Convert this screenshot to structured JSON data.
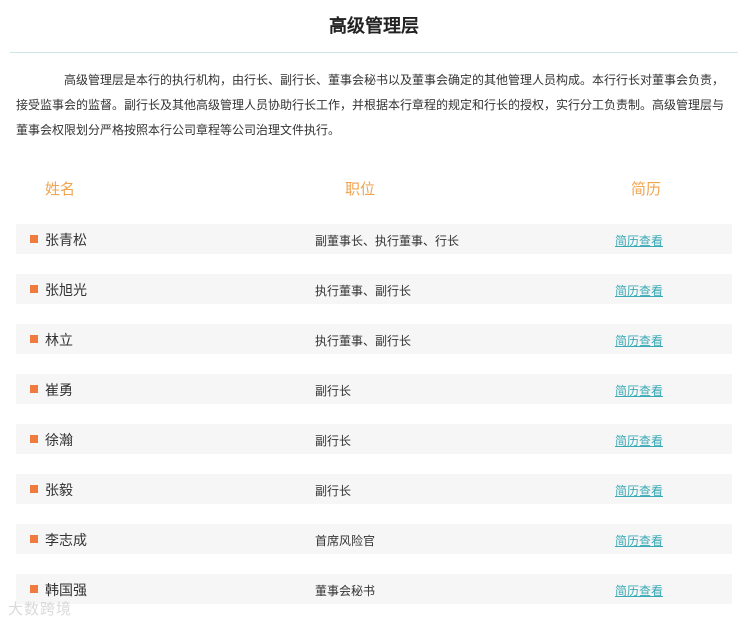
{
  "page": {
    "title": "高级管理层",
    "intro": "高级管理层是本行的执行机构，由行长、副行长、董事会秘书以及董事会确定的其他管理人员构成。本行行长对董事会负责，接受监事会的监督。副行长及其他高级管理人员协助行长工作，并根据本行章程的规定和行长的授权，实行分工负责制。高级管理层与董事会权限划分严格按照本行公司章程等公司治理文件执行。"
  },
  "table": {
    "headers": {
      "name": "姓名",
      "position": "职位",
      "resume": "简历"
    },
    "rows": [
      {
        "name": "张青松",
        "position": "副董事长、执行董事、行长",
        "link": "简历查看"
      },
      {
        "name": "张旭光",
        "position": "执行董事、副行长",
        "link": "简历查看"
      },
      {
        "name": "林立",
        "position": "执行董事、副行长",
        "link": "简历查看"
      },
      {
        "name": "崔勇",
        "position": "副行长",
        "link": "简历查看"
      },
      {
        "name": "徐瀚",
        "position": "副行长",
        "link": "简历查看"
      },
      {
        "name": "张毅",
        "position": "副行长",
        "link": "简历查看"
      },
      {
        "name": "李志成",
        "position": "首席风险官",
        "link": "简历查看"
      },
      {
        "name": "韩国强",
        "position": "董事会秘书",
        "link": "简历查看"
      }
    ]
  },
  "watermark": "大数跨境",
  "colors": {
    "header_text": "#f0a450",
    "bullet": "#ef7b3c",
    "link": "#3aa9b6",
    "row_bg": "#f6f6f6",
    "rule": "#cfe3ea"
  }
}
